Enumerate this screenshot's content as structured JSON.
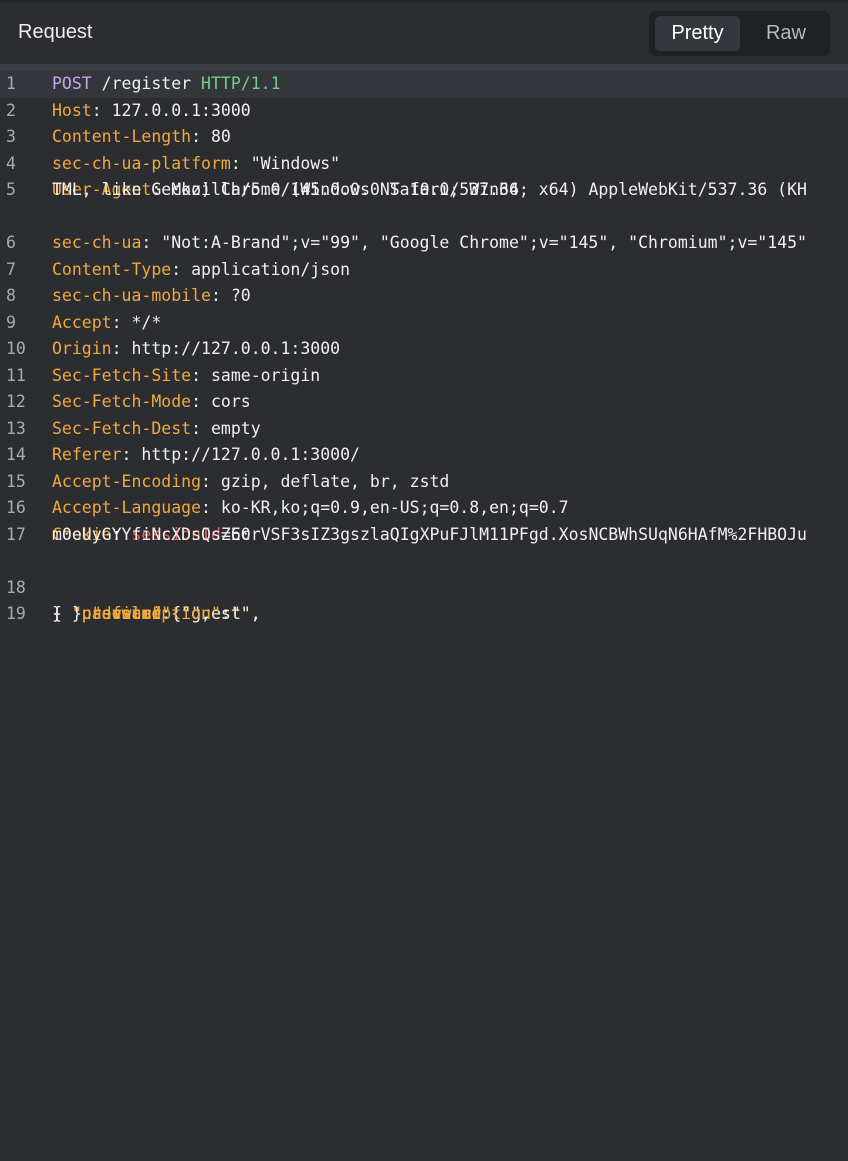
{
  "header": {
    "title": "Request",
    "view_modes": [
      "Pretty",
      "Raw"
    ],
    "selected_view": "Pretty"
  },
  "request": {
    "method": "POST",
    "path": " /register ",
    "protocol": "HTTP/1.1",
    "headers": [
      {
        "num": "2",
        "key": "Host",
        "value": "127.0.0.1:3000"
      },
      {
        "num": "3",
        "key": "Content-Length",
        "value": "80"
      },
      {
        "num": "4",
        "key": "sec-ch-ua-platform",
        "value": "\"Windows\""
      },
      {
        "num": "5",
        "key": "User-Agent",
        "value": "Mozilla/5.0 (Windows NT 10.0; Win64; x64) AppleWebKit/537.36 (KH",
        "value_cont": "TML, like Gecko) Chrome/145.0.0.0 Safari/537.36"
      },
      {
        "num": "6",
        "key": "sec-ch-ua",
        "value": "\"Not:A-Brand\";v=\"99\", \"Google Chrome\";v=\"145\", \"Chromium\";v=\"145\""
      },
      {
        "num": "7",
        "key": "Content-Type",
        "value": "application/json"
      },
      {
        "num": "8",
        "key": "sec-ch-ua-mobile",
        "value": "?0"
      },
      {
        "num": "9",
        "key": "Accept",
        "value": "*/*"
      },
      {
        "num": "10",
        "key": "Origin",
        "value": "http://127.0.0.1:3000"
      },
      {
        "num": "11",
        "key": "Sec-Fetch-Site",
        "value": "same-origin"
      },
      {
        "num": "12",
        "key": "Sec-Fetch-Mode",
        "value": "cors"
      },
      {
        "num": "13",
        "key": "Sec-Fetch-Dest",
        "value": "empty"
      },
      {
        "num": "14",
        "key": "Referer",
        "value": "http://127.0.0.1:3000/"
      },
      {
        "num": "15",
        "key": "Accept-Encoding",
        "value": "gzip, deflate, br, zstd"
      },
      {
        "num": "16",
        "key": "Accept-Language",
        "value": "ko-KR,ko;q=0.9,en-US;q=0.8,en;q=0.7"
      }
    ],
    "cookie": {
      "num": "17",
      "key": "Cookie",
      "name": "sessionId",
      "value": "=60rVSF3sIZ3gszlaQIgXPuFJlM11PFgd.XosNCBWhSUqN6HAfM%2FHBOJu",
      "value_cont": "m0eUyGYYfiNcXDsQsZEc"
    },
    "blank_line_num": "18",
    "body_line_num": "19",
    "body": {
      "open": "{",
      "username_key": "\"username\"",
      "username_val": "\"guest\"",
      "password_key": "\"password\"",
      "password_val": "\"guest\"",
      "profile_key": "\"profile\"",
      "avatar_key": "\"avatar\"",
      "avatar_val": "\"\"",
      "description_key": "\"description\"",
      "description_val": "\"\"",
      "inner_close": "}",
      "close": "}"
    }
  }
}
